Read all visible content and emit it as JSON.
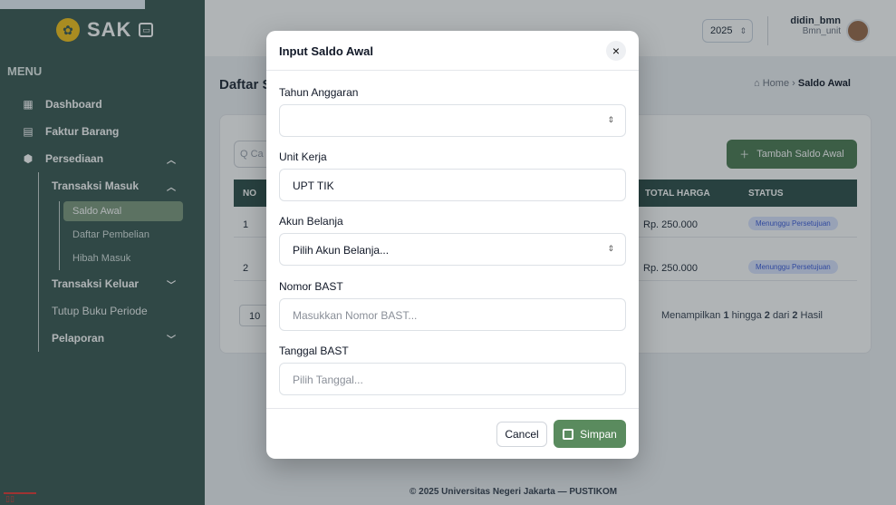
{
  "app": {
    "brand": "SAK",
    "menu_title": "MENU"
  },
  "sidebar": {
    "items": [
      {
        "label": "Dashboard",
        "icon": "dashboard-icon"
      },
      {
        "label": "Faktur Barang",
        "icon": "document-icon"
      },
      {
        "label": "Persediaan",
        "icon": "box-icon",
        "expanded": true
      }
    ],
    "persediaan_sub": {
      "transaksi_masuk": "Transaksi Masuk",
      "children": [
        "Saldo Awal",
        "Daftar Pembelian",
        "Hibah Masuk"
      ],
      "transaksi_keluar": "Transaksi Keluar",
      "tutup_buku": "Tutup Buku Periode"
    },
    "pelaporan": "Pelaporan"
  },
  "topbar": {
    "year": "2025",
    "username": "didin_bmn",
    "role": "Bmn_unit"
  },
  "page": {
    "title": "Daftar S",
    "breadcrumb": {
      "home": "Home",
      "current": "Saldo Awal"
    },
    "search_placeholder": "Q Ca",
    "add_button": "Tambah Saldo Awal",
    "columns": {
      "no": "NO",
      "total": "TOTAL HARGA",
      "status": "STATUS"
    },
    "rows": [
      {
        "no": "1",
        "total": "Rp. 250.000",
        "status": "Menunggu Persetujuan"
      },
      {
        "no": "2",
        "total": "Rp. 250.000",
        "status": "Menunggu Persetujuan"
      }
    ],
    "per_page": "10",
    "showing_prefix": "Menampilkan ",
    "showing_from": "1",
    "showing_mid": " hingga ",
    "showing_to": "2",
    "showing_of": " dari ",
    "showing_total": "2",
    "showing_suffix": " Hasil"
  },
  "footer": "© 2025 Universitas Negeri Jakarta — PUSTIKOM",
  "modal": {
    "title": "Input Saldo Awal",
    "fields": {
      "tahun_label": "Tahun Anggaran",
      "tahun_value": "",
      "unit_label": "Unit Kerja",
      "unit_value": "UPT TIK",
      "akun_label": "Akun Belanja",
      "akun_placeholder": "Pilih Akun Belanja...",
      "bast_label": "Nomor BAST",
      "bast_placeholder": "Masukkan Nomor BAST...",
      "tanggal_label": "Tanggal BAST",
      "tanggal_placeholder": "Pilih Tanggal..."
    },
    "cancel": "Cancel",
    "save": "Simpan"
  }
}
